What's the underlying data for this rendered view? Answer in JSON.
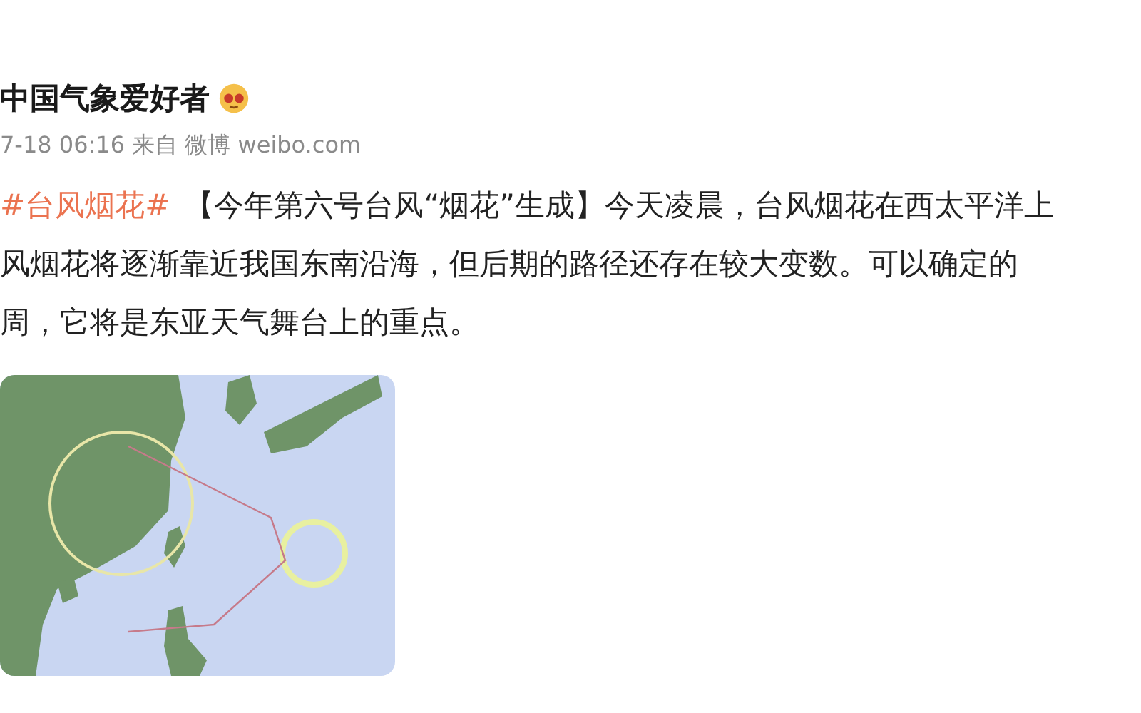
{
  "post": {
    "author": "中国气象爱好者",
    "meta": "7-18 06:16 来自 微博 weibo.com",
    "lines": [
      {
        "hashtag": "#台风烟花#",
        "text": "【今年第六号台风“烟花”生成】今天凌晨，台风烟花在西太平洋上"
      },
      {
        "text": "风烟花将逐渐靠近我国东南沿海，但后期的路径还存在较大变数。可以确定的"
      },
      {
        "text": "周，它将是东亚天气舞台上的重点。"
      }
    ]
  }
}
